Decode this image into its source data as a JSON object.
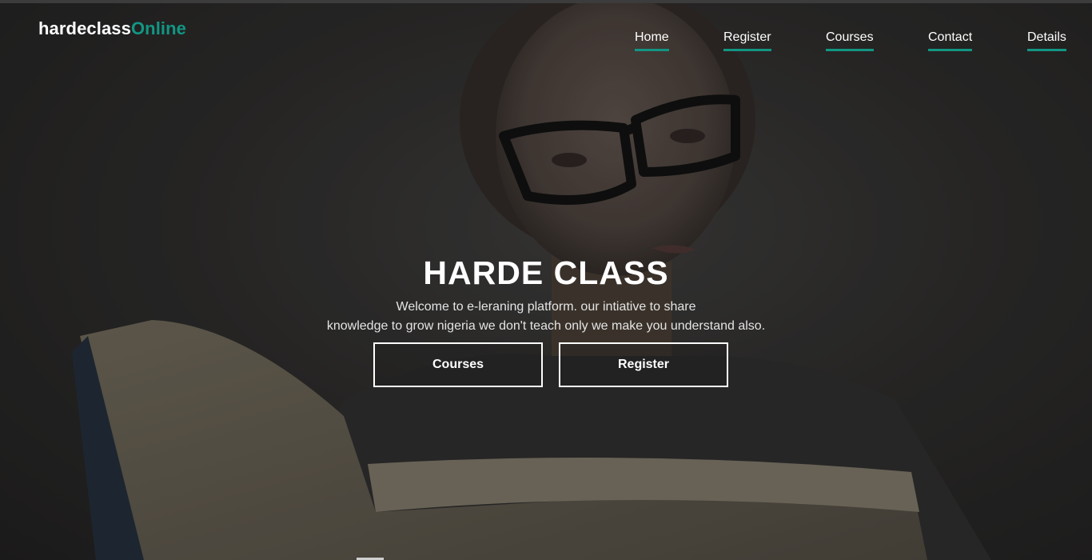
{
  "brand": {
    "name": "hardeclass",
    "accent": "Online",
    "accent_color": "#129683"
  },
  "nav": {
    "items": [
      {
        "label": "Home"
      },
      {
        "label": "Register"
      },
      {
        "label": "Courses"
      },
      {
        "label": "Contact"
      },
      {
        "label": "Details"
      }
    ]
  },
  "hero": {
    "background_image": "woman-with-glasses-reading-book",
    "title": "HARDE CLASS",
    "tagline_line1": "Welcome to e-leraning platform. our intiative to share",
    "tagline_line2": "knowledge to grow nigeria we don't teach only we make you understand also.",
    "buttons": {
      "courses_label": "Courses",
      "register_label": "Register"
    }
  }
}
